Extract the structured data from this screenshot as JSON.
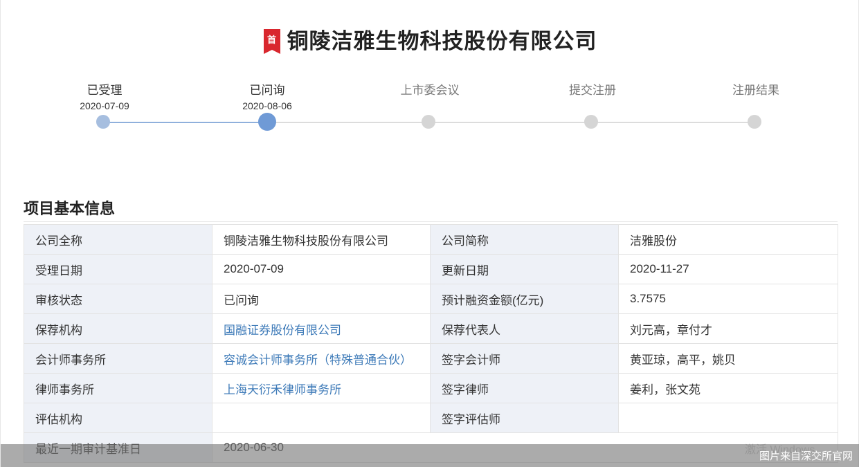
{
  "page": {
    "badge": "首",
    "title": "铜陵洁雅生物科技股份有限公司"
  },
  "progress": {
    "steps": [
      {
        "name": "已受理",
        "date": "2020-07-09",
        "state": "done"
      },
      {
        "name": "已问询",
        "date": "2020-08-06",
        "state": "current"
      },
      {
        "name": "上市委会议",
        "date": "",
        "state": "pending"
      },
      {
        "name": "提交注册",
        "date": "",
        "state": "pending"
      },
      {
        "name": "注册结果",
        "date": "",
        "state": "pending"
      }
    ],
    "colors": {
      "done": "#a6bedf",
      "current": "#6f9ad6",
      "pending": "#d5d5d5"
    }
  },
  "section": {
    "title": "项目基本信息"
  },
  "info": {
    "rows": [
      {
        "l1": "公司全称",
        "v1": "铜陵洁雅生物科技股份有限公司",
        "l2": "公司简称",
        "v2": "洁雅股份"
      },
      {
        "l1": "受理日期",
        "v1": "2020-07-09",
        "l2": "更新日期",
        "v2": "2020-11-27"
      },
      {
        "l1": "审核状态",
        "v1": "已问询",
        "l2": "预计融资金额(亿元)",
        "v2": "3.7575"
      },
      {
        "l1": "保荐机构",
        "v1": "国融证券股份有限公司",
        "l2": "保荐代表人",
        "v2": "刘元高，章付才"
      },
      {
        "l1": "会计师事务所",
        "v1": "容诚会计师事务所（特殊普通合伙）",
        "l2": "签字会计师",
        "v2": "黄亚琼，高平，姚贝"
      },
      {
        "l1": "律师事务所",
        "v1": "上海天衍禾律师事务所",
        "l2": "签字律师",
        "v2": "姜利，张文苑"
      },
      {
        "l1": "评估机构",
        "v1": "",
        "l2": "签字评估师",
        "v2": ""
      },
      {
        "l1": "最近一期审计基准日",
        "v1": "2020-06-30"
      }
    ],
    "link_color": "#3d7ab8"
  },
  "overlay": {
    "watermark": "图片来自深交所官网",
    "ghost_text": "激活 Windows"
  }
}
